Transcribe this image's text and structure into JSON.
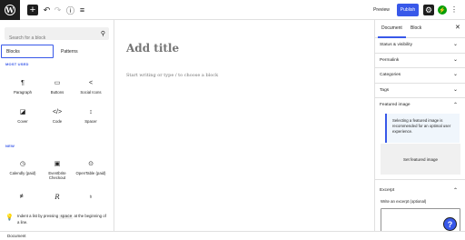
{
  "toolbar": {
    "add_icon": "+",
    "undo_icon": "↶",
    "redo_icon": "↷",
    "info_icon": "ⓘ",
    "outline_icon": "≡",
    "preview_label": "Preview",
    "publish_label": "Publish",
    "settings_icon": "⚙",
    "jetpack_icon": "⚡",
    "more_icon": "⋮",
    "logo_letter": "W",
    "publish_color": "#3858e9"
  },
  "inserter": {
    "search_placeholder": "Search for a block",
    "tabs": [
      {
        "label": "Blocks",
        "active": true
      },
      {
        "label": "Patterns",
        "active": false
      }
    ],
    "most_used_heading": "MOST USED",
    "most_used": [
      {
        "label": "Paragraph",
        "icon": "¶"
      },
      {
        "label": "Buttons",
        "icon": "▭"
      },
      {
        "label": "Social Icons",
        "icon": "<"
      },
      {
        "label": "Cover",
        "icon": "◪"
      },
      {
        "label": "Code",
        "icon": "</>"
      },
      {
        "label": "Spacer",
        "icon": "↕"
      }
    ],
    "new_heading": "NEW",
    "new_blocks": [
      {
        "label": "Calendly (paid)",
        "icon": "◷"
      },
      {
        "label": "Eventbrite Checkout",
        "icon": "▣"
      },
      {
        "label": "OpenTable (paid)",
        "icon": "⊙"
      },
      {
        "label": "",
        "icon": "≢"
      },
      {
        "label": "",
        "icon": "R"
      },
      {
        "label": "",
        "icon": "♁"
      }
    ],
    "tip": {
      "icon": "💡",
      "text_before": "Indent a list by pressing ",
      "key": "space",
      "text_after": " at the beginning of a line."
    }
  },
  "editor": {
    "title_placeholder": "Add title",
    "body_placeholder": "Start writing or type / to choose a block"
  },
  "sidebar": {
    "tabs": [
      {
        "label": "Document",
        "active": true
      },
      {
        "label": "Block",
        "active": false
      }
    ],
    "close_icon": "✕",
    "panels": [
      {
        "label": "Status & visibility",
        "chevron": "⌄"
      },
      {
        "label": "Permalink",
        "chevron": "⌄"
      },
      {
        "label": "Categories",
        "chevron": "⌄"
      },
      {
        "label": "Tags",
        "chevron": "⌄"
      },
      {
        "label": "Featured image",
        "chevron": "⌃"
      },
      {
        "label": "Excerpt",
        "chevron": "⌃"
      }
    ],
    "featured_notice": "Selecting a featured image is recommended for an optimal user experience.",
    "set_featured_label": "Set featured image",
    "excerpt_label": "Write an excerpt (optional)"
  },
  "help_icon": "?",
  "footer": {
    "breadcrumb": "Document"
  }
}
